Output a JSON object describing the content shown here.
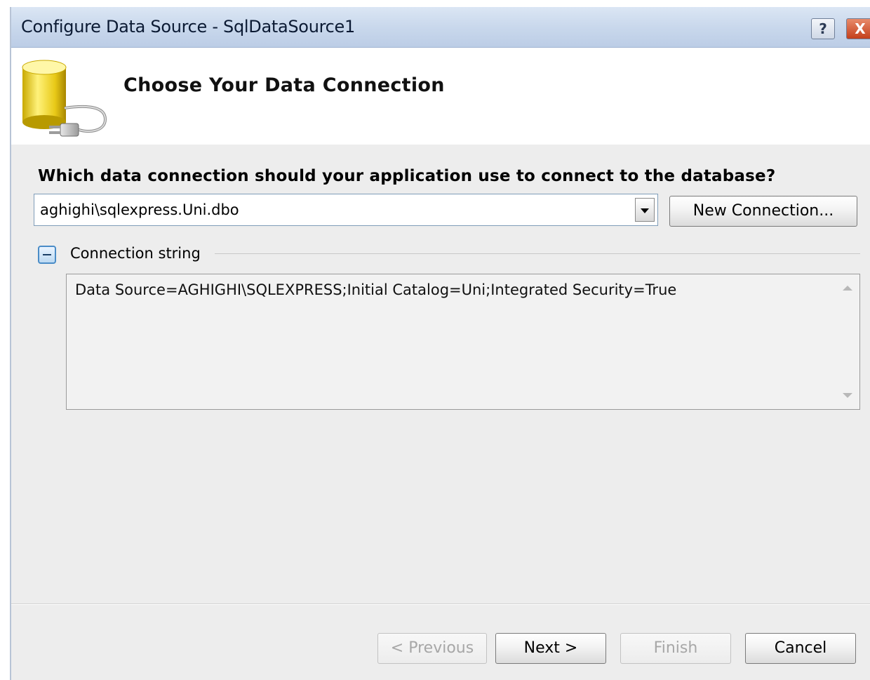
{
  "window": {
    "title": "Configure Data Source - SqlDataSource1",
    "help_label": "?",
    "close_label": "X"
  },
  "header": {
    "heading": "Choose Your Data Connection",
    "icon": "database-plug-icon"
  },
  "main": {
    "question": "Which data connection should your application use to connect to the database?",
    "connection_combo": {
      "selected_value": "aghighi\\sqlexpress.Uni.dbo"
    },
    "new_connection_label": "New Connection...",
    "connection_section": {
      "label": "Connection string",
      "expanded": true,
      "value": "Data Source=AGHIGHI\\SQLEXPRESS;Initial Catalog=Uni;Integrated Security=True"
    }
  },
  "footer": {
    "previous_label": "< Previous",
    "next_label": "Next >",
    "finish_label": "Finish",
    "cancel_label": "Cancel"
  },
  "colors": {
    "titlebar": "#c9d8ec",
    "dialog_bg": "#ededed",
    "disabled_text": "#a7a7a7"
  }
}
